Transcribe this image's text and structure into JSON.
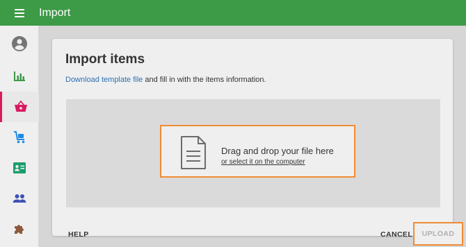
{
  "header": {
    "title": "Import",
    "menu_icon": "hamburger-menu-icon",
    "background": "#3d9a47"
  },
  "sidebar": {
    "items": [
      {
        "name": "account",
        "icon": "account-circle-icon",
        "color": "#757575"
      },
      {
        "name": "dashboard",
        "icon": "bar-chart-icon",
        "color": "#3d9a47"
      },
      {
        "name": "items",
        "icon": "basket-icon",
        "color": "#d81b60",
        "active": true
      },
      {
        "name": "sales",
        "icon": "cart-icon",
        "color": "#1e88e5"
      },
      {
        "name": "contacts",
        "icon": "contact-card-icon",
        "color": "#1b9e6b"
      },
      {
        "name": "users",
        "icon": "people-icon",
        "color": "#3f51b5"
      },
      {
        "name": "plugins",
        "icon": "puzzle-icon",
        "color": "#8d5a3b"
      }
    ]
  },
  "card": {
    "title": "Import items",
    "description_link": "Download template file",
    "description_rest": " and fill in with the items information.",
    "dropzone": {
      "title": "Drag and drop your file here",
      "link": "or select it on the computer",
      "icon": "file-document-icon"
    },
    "buttons": {
      "help": "HELP",
      "cancel": "CANCEL",
      "upload": "UPLOAD"
    }
  },
  "colors": {
    "accent": "#3d9a47",
    "highlight": "#f08a33",
    "link": "#2c6fb2",
    "active": "#d81b60"
  }
}
